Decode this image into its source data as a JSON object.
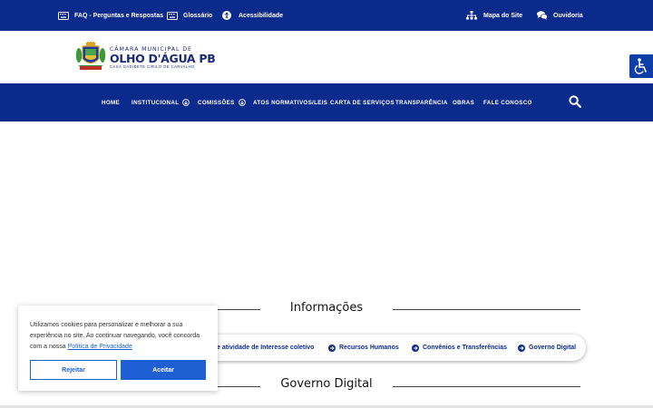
{
  "topbar": {
    "faq": {
      "label": "FAQ - Perguntas e Respostas",
      "icon": "keyboard-icon"
    },
    "glossary": {
      "label": "Glossário",
      "icon": "keyboard-icon"
    },
    "accessibility": {
      "label": "Acessibilidade",
      "icon": "accessibility-icon"
    },
    "sitemap": {
      "label": "Mapa do Site",
      "icon": "sitemap-icon"
    },
    "ombudsman": {
      "label": "Ouvidoria",
      "icon": "chat-bubbles-icon"
    }
  },
  "logo": {
    "line1": "CÂMARA MUNICIPAL DE",
    "line2": "OLHO D'ÁGUA PB",
    "line3": "CASA GADIBETE CIRILO DE CARVALHO"
  },
  "nav": {
    "items": [
      {
        "label": "HOME"
      },
      {
        "label": "INSTITUCIONAL"
      },
      {
        "label": "COMISSÕES"
      },
      {
        "label": "ATOS NORMATIVOS/LEIS"
      },
      {
        "label": "CARTA DE SERVIÇOS"
      },
      {
        "label": "TRANSPARÊNCIA"
      },
      {
        "label": "OBRAS"
      },
      {
        "label": "FALE CONOSCO"
      }
    ]
  },
  "sections": {
    "info_title": "Informações",
    "gov_title": "Governo Digital"
  },
  "info_links": [
    {
      "label": "e atividade de Interesse coletivo"
    },
    {
      "label": "Recursos Humanos"
    },
    {
      "label": "Convênios e Transferências"
    },
    {
      "label": "Governo Digital"
    }
  ],
  "cookie": {
    "text": "Utilizamos cookies para personalizar e melhorar a sua experiência no site. Ao continuar navegando, você concorda com a nossa",
    "link": "Política de Privacidade",
    "reject": "Rejeitar",
    "accept": "Aceitar"
  },
  "colors": {
    "primary": "#0a2a8c",
    "accent": "#1e5fd4"
  }
}
